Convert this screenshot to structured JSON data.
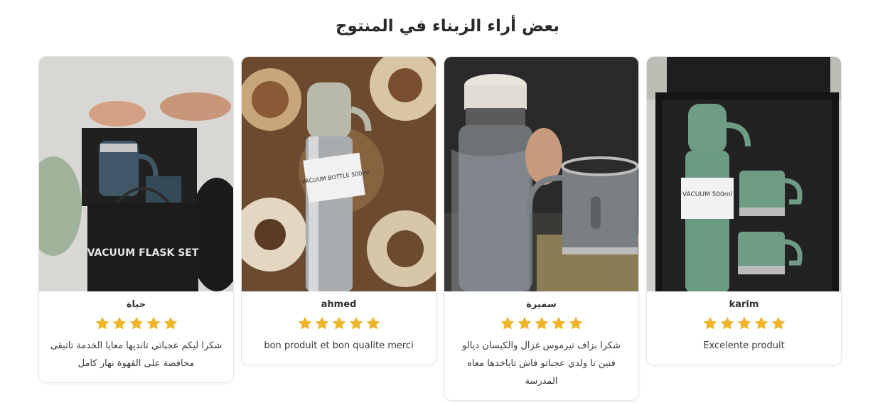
{
  "section": {
    "title": "بعض أراء الزبناء في المنتوج"
  },
  "colors": {
    "star": "#f0b429",
    "card_border": "#e6e6e6"
  },
  "reviews": [
    {
      "name": "karim",
      "rating": 5,
      "comment": "Excelente produit",
      "dir": "ltr",
      "photo_text": "VACUUM 500ml"
    },
    {
      "name": "سميرة",
      "rating": 5,
      "comment": "شكرا بزاف تيرموس غزال والكيسان ديالو فنين تا ولدي عجباتو فاش تاياخدها معاه المدرسة",
      "dir": "rtl",
      "photo_text": ""
    },
    {
      "name": "ahmed",
      "rating": 5,
      "comment": "bon produit et bon qualite merci",
      "dir": "ltr",
      "photo_text": "VACUUM BOTTLE 500ml"
    },
    {
      "name": "حياة",
      "rating": 5,
      "comment": "شكرا ليكم عجباتي تانديها معايا الخدمة تاتبقى محافضة على القهوة نهار كامل",
      "dir": "rtl",
      "photo_text": "VACUUM FLASK SET"
    }
  ]
}
